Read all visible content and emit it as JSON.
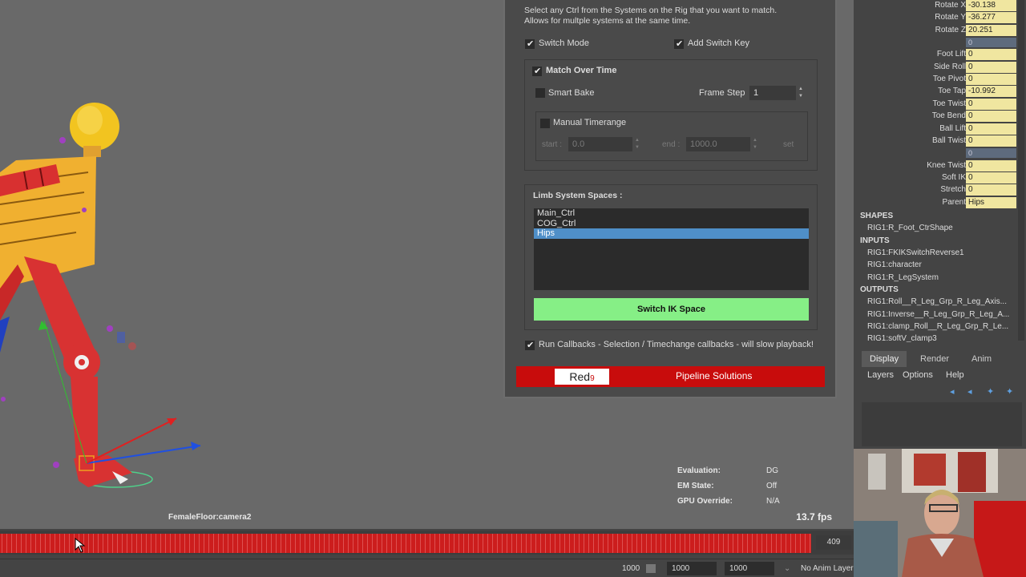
{
  "dialog": {
    "instructions_line1": "Select any Ctrl from the Systems on the Rig that you want to match.",
    "instructions_line2": "Allows for multple systems at the same time.",
    "switch_mode_label": "Switch Mode",
    "switch_mode_checked": true,
    "add_switch_key_label": "Add Switch Key",
    "add_switch_key_checked": true,
    "match_over_time_label": "Match Over Time",
    "match_over_time_checked": true,
    "smart_bake_label": "Smart Bake",
    "smart_bake_checked": false,
    "frame_step_label": "Frame Step",
    "frame_step_value": "1",
    "manual_timerange_label": "Manual Timerange",
    "manual_timerange_checked": false,
    "start_label": "start :",
    "start_value": "0.0",
    "end_label": "end :",
    "end_value": "1000.0",
    "set_label": "set",
    "limb_spaces_label": "Limb System Spaces :",
    "spaces": [
      "Main_Ctrl",
      "COG_Ctrl",
      "Hips"
    ],
    "selected_space": "Hips",
    "switch_button_label": "Switch IK Space",
    "run_callbacks_label": "Run Callbacks - Selection / Timechange callbacks - will slow playback!",
    "run_callbacks_checked": true,
    "logo_text": "Red",
    "logo_suffix": "9",
    "banner_text": "Pipeline Solutions"
  },
  "channel_box": {
    "attributes": [
      {
        "label": "Rotate X",
        "value": "-30.138"
      },
      {
        "label": "Rotate Y",
        "value": "-36.277"
      },
      {
        "label": "Rotate Z",
        "value": "20.251"
      },
      {
        "label": "",
        "value": "0",
        "separator": true
      },
      {
        "label": "Foot Lift",
        "value": "0"
      },
      {
        "label": "Side Roll",
        "value": "0"
      },
      {
        "label": "Toe Pivot",
        "value": "0"
      },
      {
        "label": "Toe Tap",
        "value": "-10.992"
      },
      {
        "label": "Toe Twist",
        "value": "0"
      },
      {
        "label": "Toe Bend",
        "value": "0"
      },
      {
        "label": "Ball Lift",
        "value": "0"
      },
      {
        "label": "Ball Twist",
        "value": "0"
      },
      {
        "label": "",
        "value": "0",
        "separator": true
      },
      {
        "label": "Knee Twist",
        "value": "0"
      },
      {
        "label": "Soft IK",
        "value": "0"
      },
      {
        "label": "Stretch",
        "value": "0"
      },
      {
        "label": "Parent",
        "value": "Hips"
      }
    ],
    "shapes_header": "SHAPES",
    "shapes": [
      "RIG1:R_Foot_CtrShape"
    ],
    "inputs_header": "INPUTS",
    "inputs": [
      "RIG1:FKIKSwitchReverse1",
      "RIG1:character",
      "RIG1:R_LegSystem"
    ],
    "outputs_header": "OUTPUTS",
    "outputs": [
      "RIG1:Roll__R_Leg_Grp_R_Leg_Axis...",
      "RIG1:Inverse__R_Leg_Grp_R_Leg_A...",
      "RIG1:clamp_Roll__R_Leg_Grp_R_Le...",
      "RIG1:softV_clamp3"
    ]
  },
  "layer_editor": {
    "tabs": [
      "Display",
      "Render",
      "Anim"
    ],
    "active_tab": "Display",
    "menus": [
      "Layers",
      "Options",
      "Help"
    ]
  },
  "viewport": {
    "camera_label": "FemaleFloor:camera2",
    "fps": "13.7 fps",
    "hud": [
      {
        "label": "Evaluation:",
        "value": "DG"
      },
      {
        "label": "EM State:",
        "value": "Off"
      },
      {
        "label": "GPU Override:",
        "value": "N/A"
      }
    ]
  },
  "timeline": {
    "current_frame_box": "409",
    "range_start_a": "1000",
    "range_start_b": "1000",
    "range_end": "1000",
    "anim_layer": "No Anim Layer"
  },
  "colors": {
    "timeline": "#cc1d1d",
    "switch_button": "#86ef86",
    "banner": "#c80c0c",
    "attr_field": "#f0e6a0",
    "selection": "#4f8fc8"
  }
}
